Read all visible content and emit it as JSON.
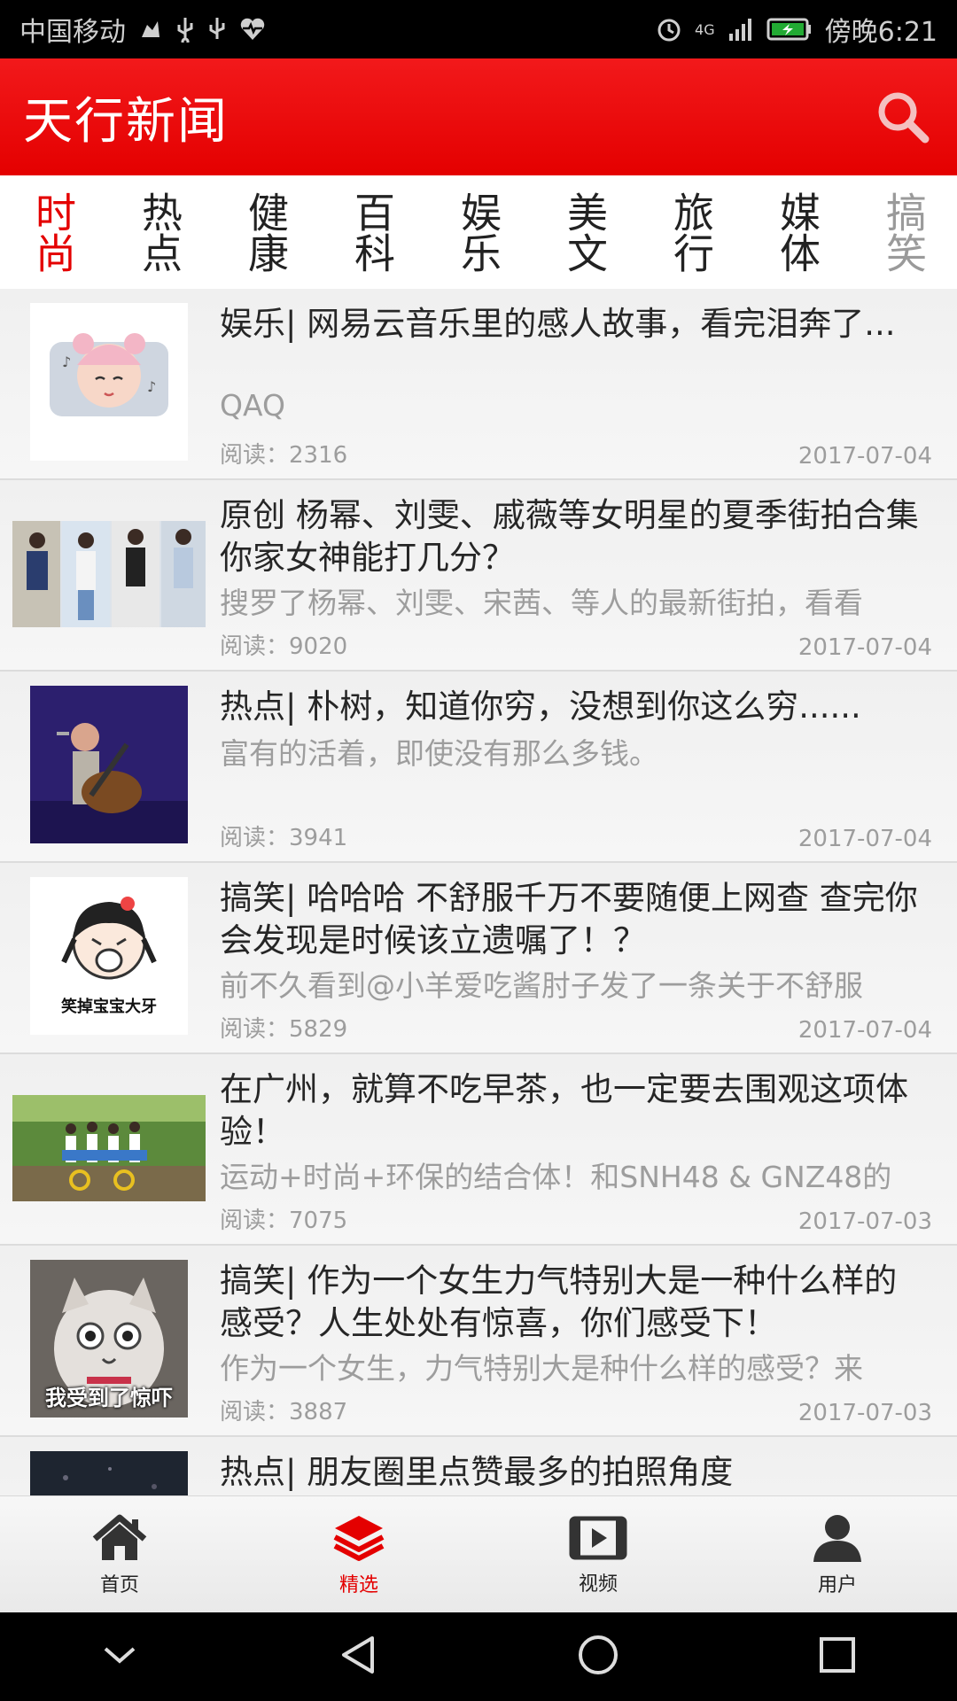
{
  "status_bar": {
    "carrier": "中国移动",
    "network": "4G",
    "time": "傍晚6:21"
  },
  "header": {
    "title": "天行新闻"
  },
  "tabs": [
    {
      "label": "时尚"
    },
    {
      "label": "热点"
    },
    {
      "label": "健康"
    },
    {
      "label": "百科"
    },
    {
      "label": "娱乐"
    },
    {
      "label": "美文"
    },
    {
      "label": "旅行"
    },
    {
      "label": "媒体"
    },
    {
      "label": "搞笑"
    }
  ],
  "news": [
    {
      "title": "娱乐| 网易云音乐里的感人故事，看完泪奔了...",
      "summary": "QAQ",
      "reads": "阅读：2316",
      "date": "2017-07-04"
    },
    {
      "title": "原创 杨幂、刘雯、戚薇等女明星的夏季街拍合集 你家女神能打几分？",
      "summary": "搜罗了杨幂、刘雯、宋茜、等人的最新街拍，看看",
      "reads": "阅读：9020",
      "date": "2017-07-04"
    },
    {
      "title": "热点| 朴树，知道你穷，没想到你这么穷......",
      "summary": "富有的活着，即使没有那么多钱。",
      "reads": "阅读：3941",
      "date": "2017-07-04"
    },
    {
      "title": "搞笑| 哈哈哈 不舒服千万不要随便上网查 查完你会发现是时候该立遗嘱了！？",
      "summary": "前不久看到@小羊爱吃酱肘子发了一条关于不舒服",
      "reads": "阅读：5829",
      "date": "2017-07-04",
      "thumb_caption": "笑掉宝宝大牙"
    },
    {
      "title": "在广州，就算不吃早茶，也一定要去围观这项体验！",
      "summary": "运动+时尚+环保的结合体！和SNH48 & GNZ48的",
      "reads": "阅读：7075",
      "date": "2017-07-03"
    },
    {
      "title": "搞笑| 作为一个女生力气特别大是一种什么样的感受？人生处处有惊喜，你们感受下！",
      "summary": "作为一个女生，力气特别大是种什么样的感受？来",
      "reads": "阅读：3887",
      "date": "2017-07-03",
      "thumb_caption": "我受到了惊吓"
    },
    {
      "title": "热点| 朋友圈里点赞最多的拍照角度",
      "summary": "",
      "reads": "",
      "date": ""
    }
  ],
  "bottom_nav": [
    {
      "label": "首页",
      "icon": "home-icon"
    },
    {
      "label": "精选",
      "icon": "layers-icon"
    },
    {
      "label": "视频",
      "icon": "video-icon"
    },
    {
      "label": "用户",
      "icon": "user-icon"
    }
  ],
  "colors": {
    "accent": "#e40000",
    "header_bg": "#ee0a0b",
    "muted_text": "#9d9d9d"
  }
}
